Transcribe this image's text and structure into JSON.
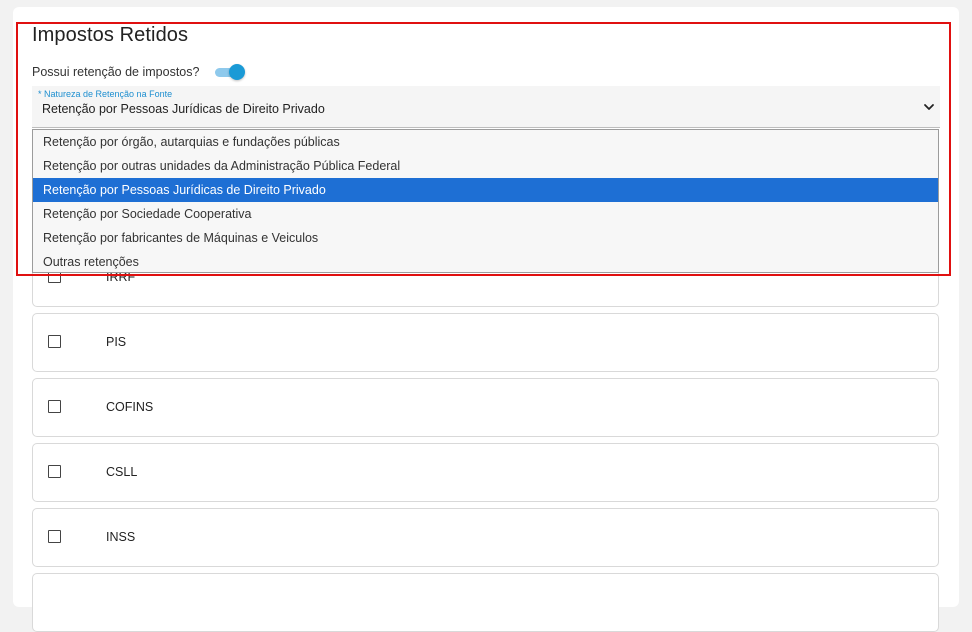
{
  "section": {
    "title": "Impostos Retidos",
    "toggle_label": "Possui retenção de impostos?",
    "toggle_on": true
  },
  "select": {
    "label": "* Natureza de Retenção na Fonte",
    "value": "Retenção por Pessoas Jurídicas de Direito Privado",
    "icon": "chevron-down-icon"
  },
  "dropdown": {
    "options": [
      "Retenção por órgão, autarquias e fundações públicas",
      "Retenção por outras unidades da Administração Pública Federal",
      "Retenção por Pessoas Jurídicas de Direito Privado",
      "Retenção por Sociedade Cooperativa",
      "Retenção por fabricantes de Máquinas e Veiculos",
      "Outras retenções"
    ],
    "selected_index": 2
  },
  "taxes": [
    {
      "label": "IRRF",
      "checked": false
    },
    {
      "label": "PIS",
      "checked": false
    },
    {
      "label": "COFINS",
      "checked": false
    },
    {
      "label": "CSLL",
      "checked": false
    },
    {
      "label": "INSS",
      "checked": false
    }
  ],
  "colors": {
    "accent": "#1a9ad6",
    "selected_option_bg": "#1e6fd4",
    "highlight_box": "#e01010",
    "label_blue": "#1e8fd0"
  }
}
